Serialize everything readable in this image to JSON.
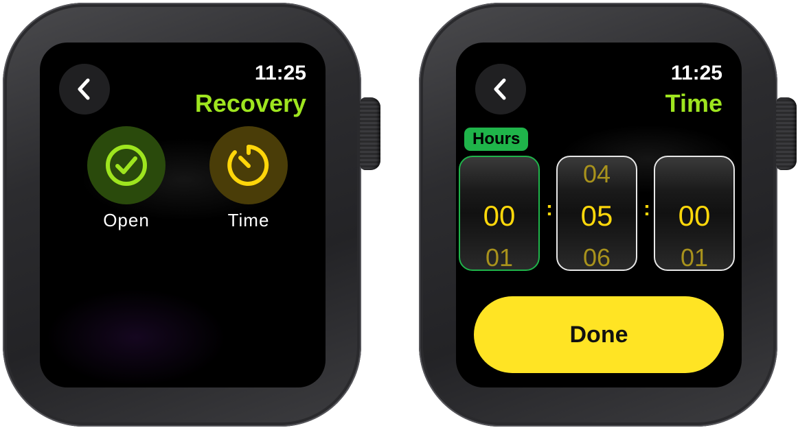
{
  "colors": {
    "accent_green": "#9ee51f",
    "accent_yellow": "#ffe424",
    "badge_green": "#1fb44a"
  },
  "left_screen": {
    "time": "11:25",
    "title": "Recovery",
    "back_icon": "chevron-left-icon",
    "actions": [
      {
        "label": "Open",
        "icon": "checkmark-circle-icon"
      },
      {
        "label": "Time",
        "icon": "timer-icon"
      }
    ]
  },
  "right_screen": {
    "time": "11:25",
    "title": "Time",
    "back_icon": "chevron-left-icon",
    "picker_label": "Hours",
    "wheels": [
      {
        "prev": "",
        "value": "00",
        "next": "01"
      },
      {
        "prev": "04",
        "value": "05",
        "next": "06"
      },
      {
        "prev": "",
        "value": "00",
        "next": "01"
      }
    ],
    "separator": ":",
    "done_label": "Done"
  }
}
